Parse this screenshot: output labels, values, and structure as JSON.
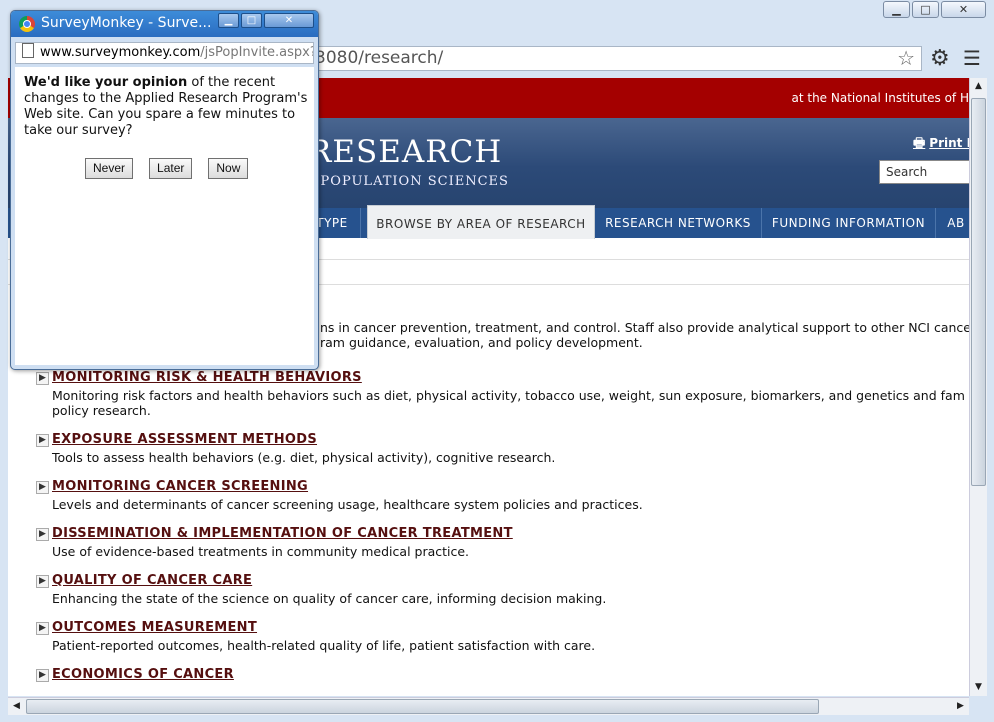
{
  "window": {
    "minimize": "▁",
    "maximize": "□",
    "close": "✕"
  },
  "toolbar": {
    "url": "3080/research/",
    "star": "☆",
    "gear": "⚙",
    "menu": "☰"
  },
  "page": {
    "nih": "at the National Institutes of H",
    "logo": "RESEARCH",
    "logo_sub": "D POPULATION SCIENCES",
    "print": "Print P",
    "printer": "🖶",
    "search": "Search",
    "nav": [
      {
        "label": "TYPE"
      },
      {
        "label": "BROWSE BY AREA OF RESEARCH"
      },
      {
        "label": "RESEARCH NETWORKS"
      },
      {
        "label": "FUNDING INFORMATION"
      },
      {
        "label": "AB"
      }
    ],
    "intro_1": "ns in cancer prevention, treatment, and control. Staff also provide analytical support to other NCI cancer",
    "intro_2": "ram guidance, evaluation, and policy development.",
    "items": [
      {
        "title": "MONITORING RISK & HEALTH BEHAVIORS",
        "desc": "Monitoring risk factors and health behaviors such as diet, physical activity, tobacco use, weight, sun exposure, biomarkers, and genetics and fam",
        "desc2": "policy research."
      },
      {
        "title": "EXPOSURE ASSESSMENT METHODS",
        "desc": "Tools to assess health behaviors (e.g. diet, physical activity), cognitive research."
      },
      {
        "title": "MONITORING CANCER SCREENING",
        "desc": "Levels and determinants of cancer screening usage, healthcare system policies and practices."
      },
      {
        "title": "DISSEMINATION & IMPLEMENTATION OF CANCER TREATMENT",
        "desc": "Use of evidence-based treatments in community medical practice."
      },
      {
        "title": "QUALITY OF CANCER CARE",
        "desc": "Enhancing the state of the science on quality of cancer care, informing decision making."
      },
      {
        "title": "OUTCOMES MEASUREMENT",
        "desc": "Patient-reported outcomes, health-related quality of life, patient satisfaction with care."
      },
      {
        "title": "ECONOMICS OF CANCER",
        "desc": ""
      }
    ]
  },
  "popup": {
    "title": "SurveyMonkey - Surve...",
    "url_host": "www.surveymonkey.com",
    "url_path": "/jsPopInvite.aspx?",
    "text_bold": "We'd like your opinion",
    "text_rest": " of the recent changes to the Applied Research Program's Web site. Can you spare a few minutes to take our survey?",
    "buttons": {
      "never": "Never",
      "later": "Later",
      "now": "Now"
    }
  },
  "scroll": {
    "up": "▲",
    "down": "▼",
    "left": "◀",
    "right": "▶"
  }
}
